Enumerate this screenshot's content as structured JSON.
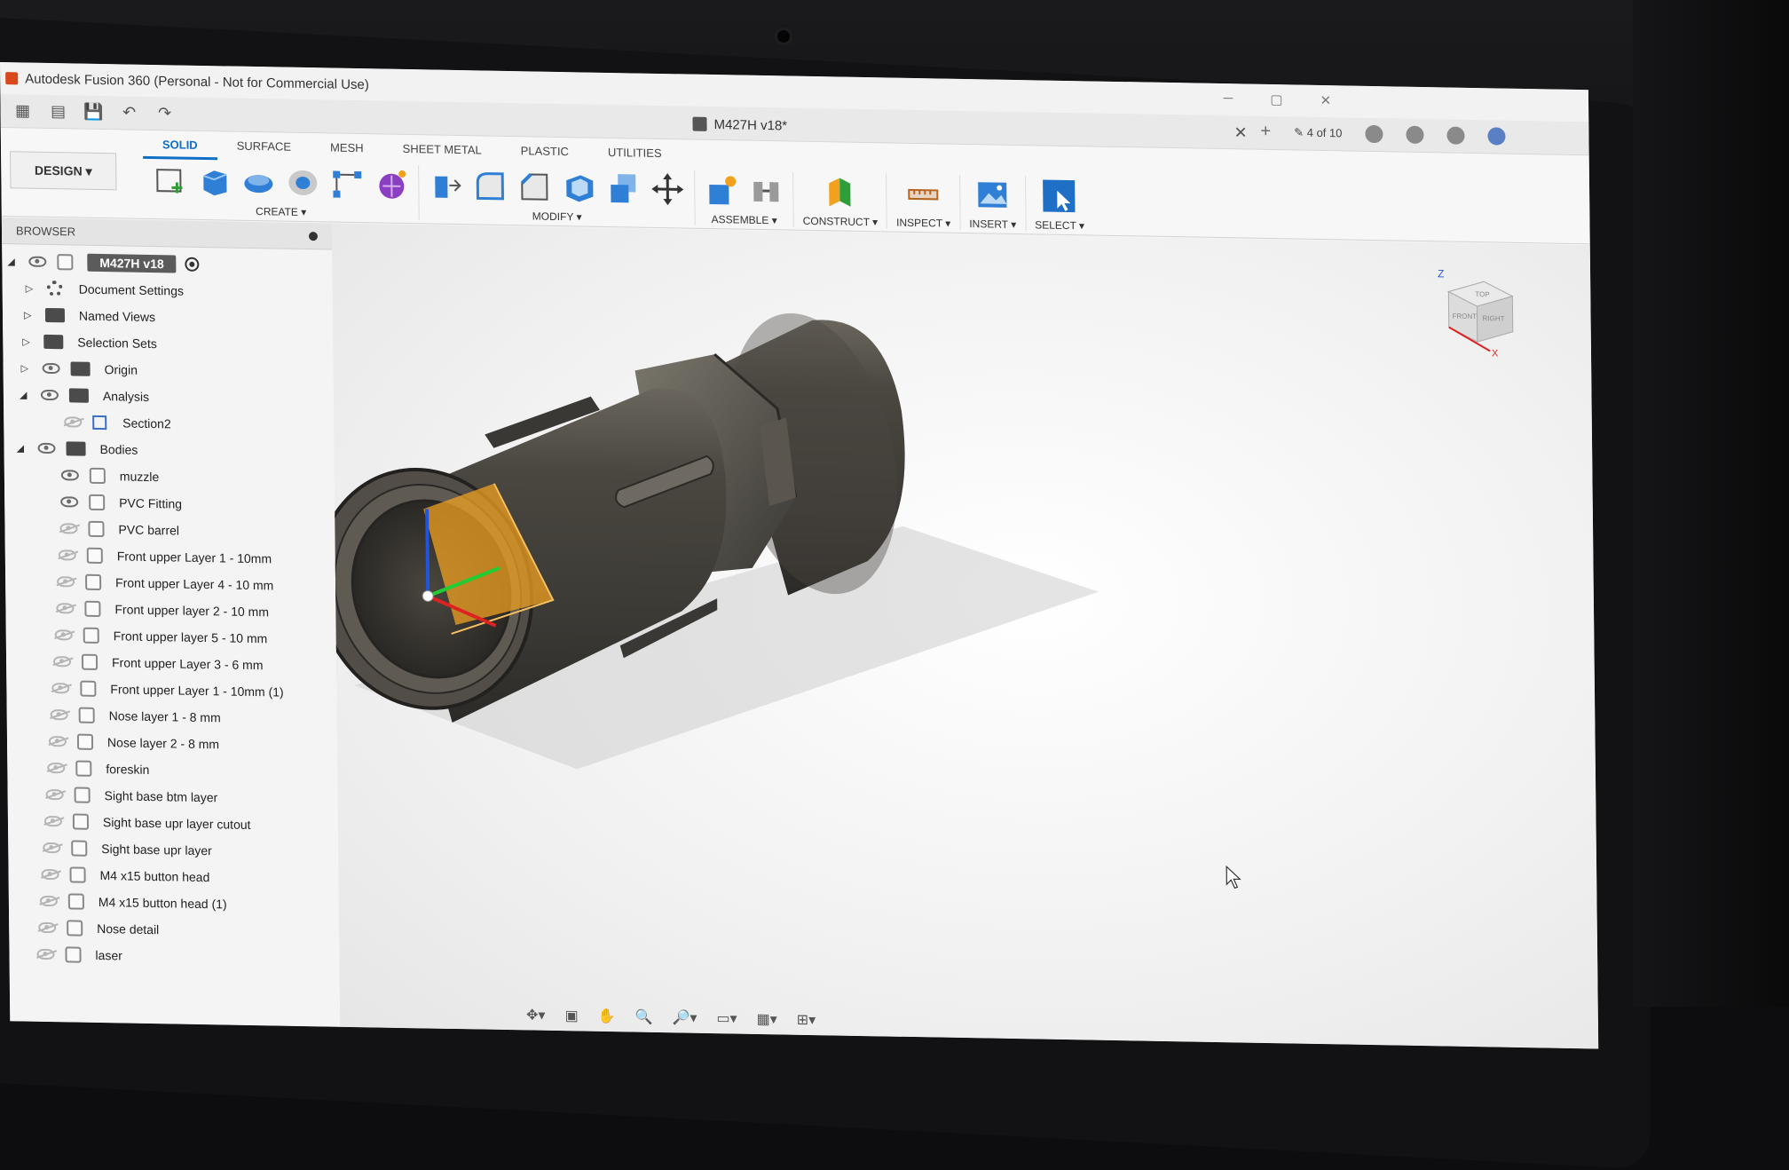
{
  "window": {
    "title": "Autodesk Fusion 360 (Personal - Not for Commercial Use)",
    "minimize": "─",
    "maximize": "▢",
    "close": "✕"
  },
  "quick_access": {
    "document_tab": "M427H v18*",
    "close_tab": "✕",
    "version_count": "4 of 10"
  },
  "toolbar": {
    "workspace": "DESIGN ▾",
    "tabs": [
      "SOLID",
      "SURFACE",
      "MESH",
      "SHEET METAL",
      "PLASTIC",
      "UTILITIES"
    ],
    "groups": [
      "CREATE ▾",
      "MODIFY ▾",
      "ASSEMBLE ▾",
      "CONSTRUCT ▾",
      "INSPECT ▾",
      "INSERT ▾",
      "SELECT ▾"
    ]
  },
  "browser": {
    "title": "BROWSER",
    "root": "M427H v18",
    "items": [
      "Document Settings",
      "Named Views",
      "Selection Sets",
      "Origin",
      "Analysis",
      "Section2",
      "Bodies"
    ],
    "bodies": [
      "muzzle",
      "PVC Fitting",
      "PVC barrel",
      "Front upper Layer 1 - 10mm",
      "Front upper Layer 4 - 10 mm",
      "Front upper layer 2 - 10 mm",
      "Front upper layer 5 - 10 mm",
      "Front upper Layer 3 - 6 mm",
      "Front upper Layer 1 - 10mm (1)",
      "Nose layer 1 - 8 mm",
      "Nose layer 2 - 8 mm",
      "foreskin",
      "Sight base btm layer",
      "Sight base upr layer cutout",
      "Sight base upr layer",
      "M4 x15 button head",
      "M4 x15 button head (1)",
      "Nose detail",
      "laser"
    ]
  },
  "viewcube": {
    "axis_z": "Z",
    "axis_x": "X",
    "top": "TOP",
    "front": "FRONT",
    "right": "RIGHT"
  },
  "colors": {
    "accent": "#0f6fc6",
    "model": "#5e5a52",
    "section_plane": "#f0a020"
  }
}
